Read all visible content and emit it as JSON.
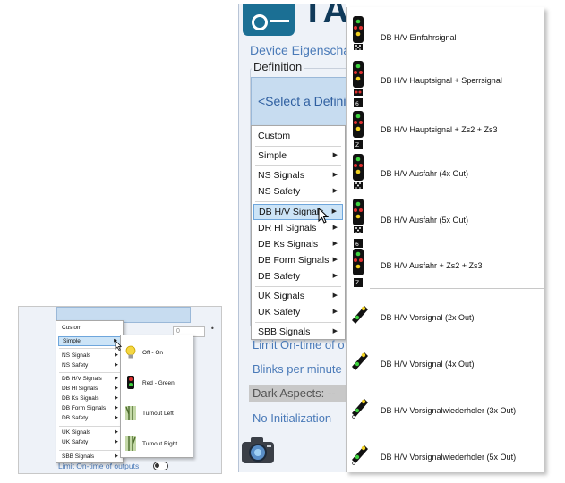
{
  "main": {
    "device_title": "Device Eigenschapp",
    "definition_label": "Definition",
    "select_placeholder": "<Select a Definiti",
    "limit_text": "Limit On-time of o",
    "blinks_text": "Blinks per minute",
    "dark_aspects": "Dark Aspects: --",
    "no_init": "No Initialization"
  },
  "menu": {
    "items": [
      "Custom",
      "Simple",
      "NS Signals",
      "NS Safety",
      "DB H/V Signals",
      "DR Hl Signals",
      "DB Ks Signals",
      "DB Form Signals",
      "DB Safety",
      "UK Signals",
      "UK Safety",
      "SBB Signals"
    ]
  },
  "signals": {
    "items": [
      "DB H/V Einfahrsignal",
      "DB H/V Hauptsignal + Sperrsignal",
      "DB H/V Hauptsignal + Zs2 + Zs3",
      "DB H/V Ausfahr (4x Out)",
      "DB H/V Ausfahr (5x Out)",
      "DB H/V Ausfahr + Zs2 + Zs3",
      "DB H/V Vorsignal (2x Out)",
      "DB H/V Vorsignal (4x Out)",
      "DB H/V Vorsignalwiederholer (3x Out)",
      "DB H/V Vorsignalwiederholer (5x Out)"
    ],
    "sub_labels": [
      "6",
      "Z",
      "6",
      "Z"
    ]
  },
  "inset": {
    "number_value": "0",
    "limit_text": "Limit On-time of outputs",
    "menu_items": [
      "Custom",
      "Simple",
      "NS Signals",
      "NS Safety",
      "DB H/V Signals",
      "DB Hl Signals",
      "DB Ks Signals",
      "DB Form Signals",
      "DB Safety",
      "UK Signals",
      "UK Safety",
      "SBB Signals"
    ],
    "sub_items": [
      "Off - On",
      "Red - Green",
      "Turnout Left",
      "Turnout Right"
    ]
  }
}
